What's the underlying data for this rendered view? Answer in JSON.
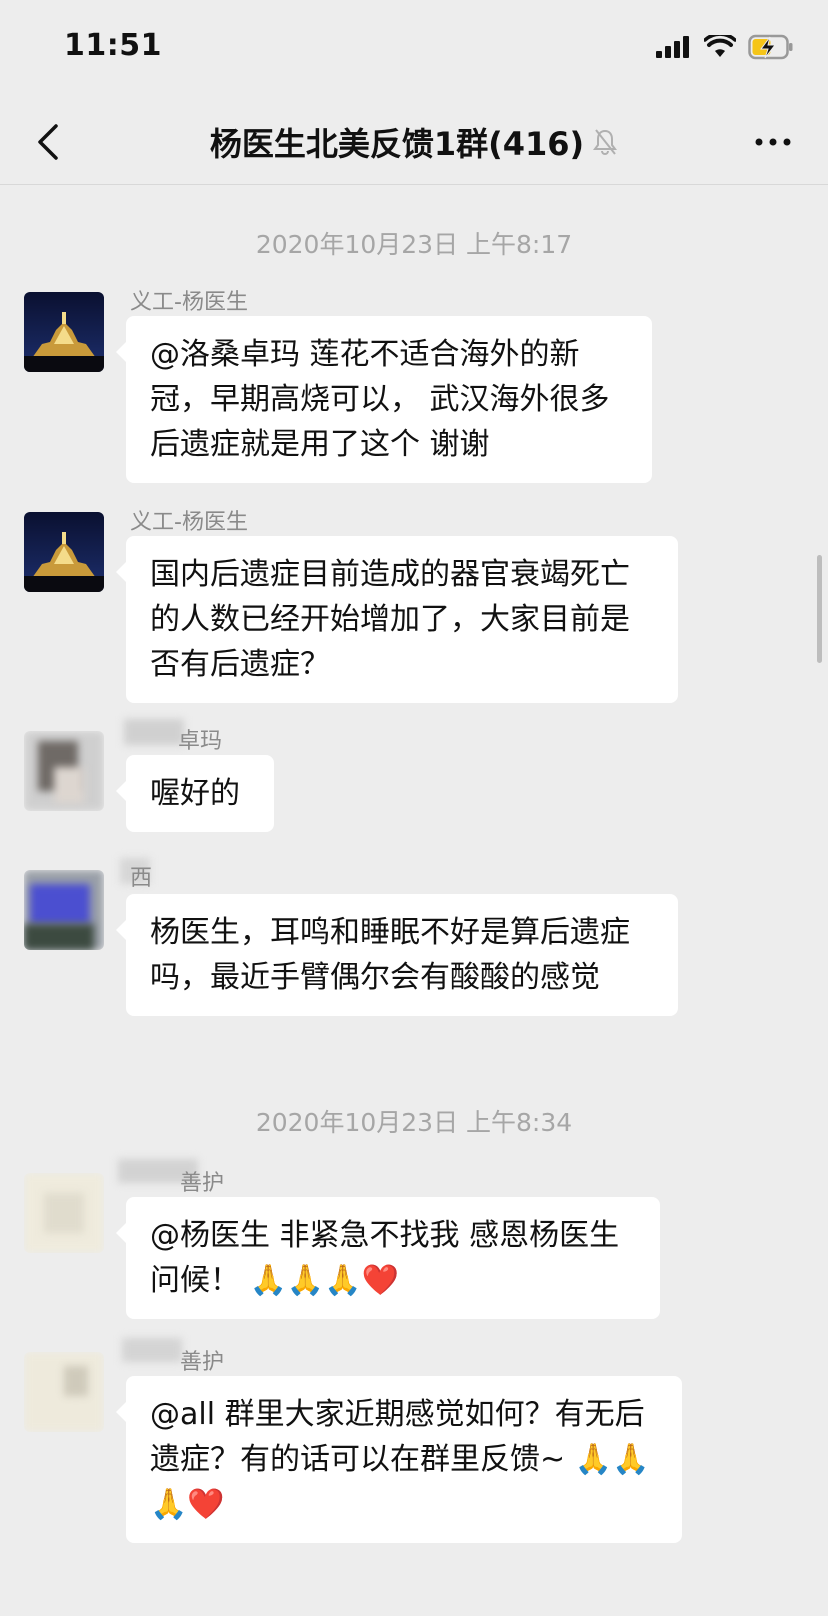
{
  "status_bar": {
    "time": "11:51"
  },
  "header": {
    "title": "杨医生北美反馈1群(416)"
  },
  "timestamps": [
    "2020年10月23日 上午8:17",
    "2020年10月23日 上午8:34"
  ],
  "messages": [
    {
      "sender": "义工-杨医生",
      "text": "@洛桑卓玛 莲花不适合海外的新冠，早期高烧可以， 武汉海外很多后遗症就是用了这个 谢谢"
    },
    {
      "sender": "义工-杨医生",
      "text": "国内后遗症目前造成的器官衰竭死亡的人数已经开始增加了，大家目前是否有后遗症？"
    },
    {
      "sender": "卓玛",
      "text": "喔好的"
    },
    {
      "sender": "西",
      "text": "杨医生，耳鸣和睡眠不好是算后遗症吗，最近手臂偶尔会有酸酸的感觉"
    },
    {
      "sender": "善护",
      "text": "@杨医生 非紧急不找我 感恩杨医生问候！ 🙏🙏🙏❤️"
    },
    {
      "sender": "善护",
      "text": "@all 群里大家近期感觉如何？有无后遗症？有的话可以在群里反馈~ 🙏🙏🙏❤️"
    }
  ],
  "colors": {
    "chat_bg": "#ededed",
    "bubble_bg": "#ffffff",
    "meta_text": "#a6a6a6"
  },
  "icons": [
    "back-chevron-icon",
    "mute-bell-icon",
    "more-dots-icon",
    "signal-icon",
    "wifi-icon",
    "battery-charging-icon"
  ]
}
